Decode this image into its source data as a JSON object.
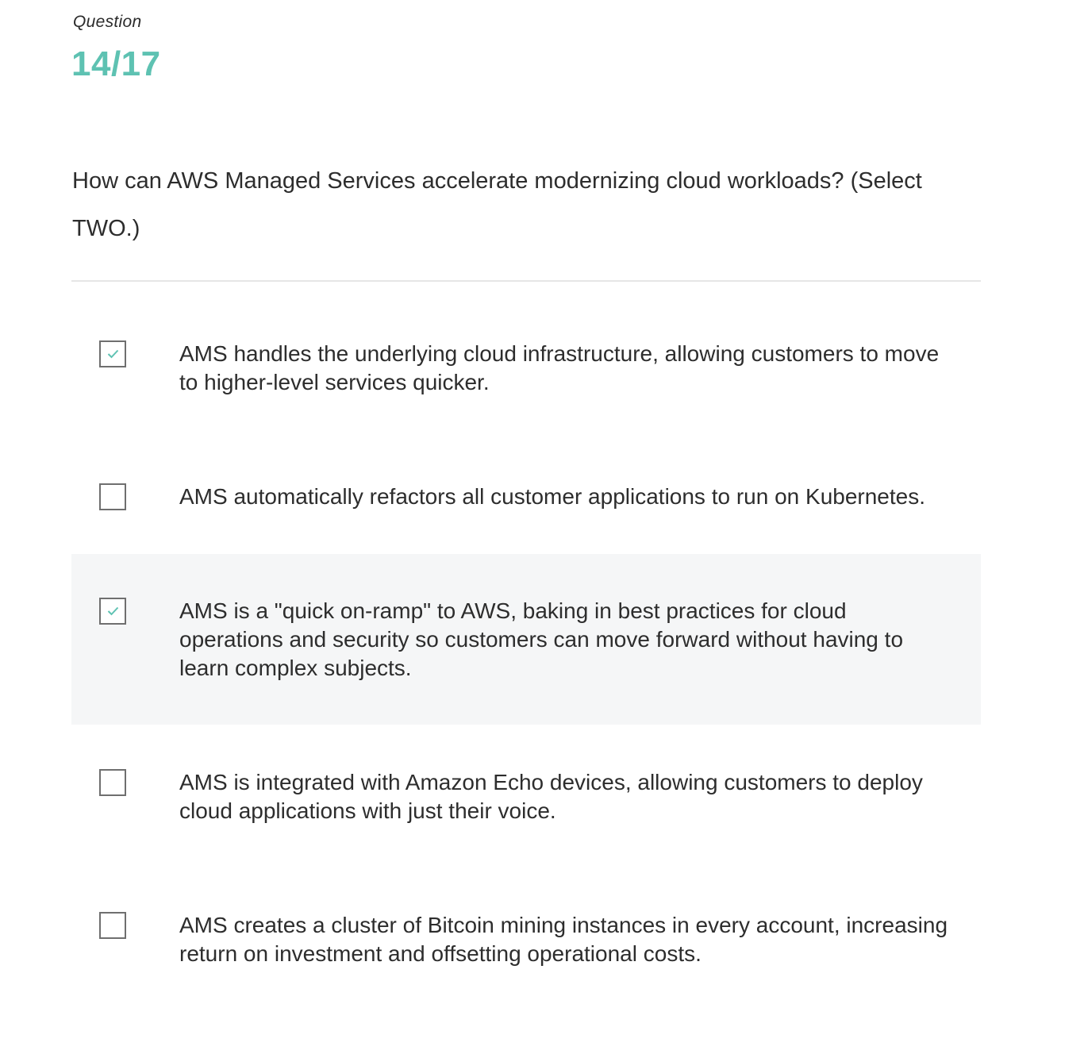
{
  "header": {
    "label": "Question",
    "counter": "14/17"
  },
  "question": {
    "text": "How can AWS Managed Services accelerate modernizing cloud workloads? (Select TWO.)"
  },
  "accent_color": "#5ec2b2",
  "options": [
    {
      "text": "AMS handles the underlying cloud infrastructure, allowing customers to move to higher-level services quicker.",
      "checked": true
    },
    {
      "text": "AMS automatically refactors all customer applications to run on Kubernetes.",
      "checked": false
    },
    {
      "text": "AMS is a \"quick on-ramp\" to AWS, baking in best practices for cloud operations and security so customers can move forward without having to learn complex subjects.",
      "checked": true
    },
    {
      "text": "AMS is integrated with Amazon Echo devices, allowing customers to deploy cloud applications with just their voice.",
      "checked": false
    },
    {
      "text": "AMS creates a cluster of Bitcoin mining instances in every account, increasing return on investment and offsetting operational costs.",
      "checked": false
    }
  ]
}
